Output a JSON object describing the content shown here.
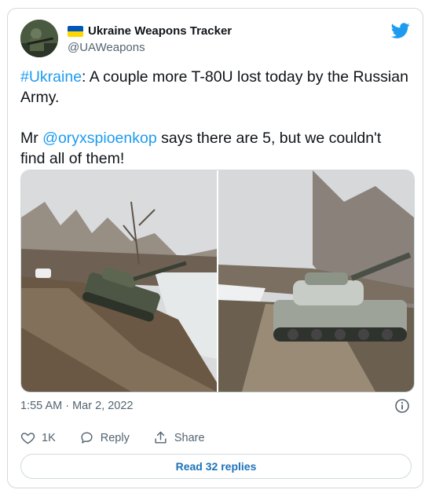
{
  "tweet": {
    "display_name": "Ukraine Weapons Tracker",
    "handle": "@UAWeapons",
    "text_line1_hashtag": "#Ukraine",
    "text_line1_rest": ": A couple more T-80U lost today by the Russian Army.",
    "text_line2_prefix": "Mr ",
    "text_line2_mention": "@oryxspioenkop",
    "text_line2_rest": " says there are 5, but we couldn't find all of them!",
    "timestamp": "1:55 AM · Mar 2, 2022",
    "likes_count": "1K",
    "reply_label": "Reply",
    "share_label": "Share",
    "read_replies_label": "Read 32 replies"
  },
  "icons": {
    "brand": "twitter-bird-icon",
    "info": "info-icon",
    "like": "heart-icon",
    "reply": "reply-icon",
    "share": "share-icon"
  },
  "colors": {
    "link": "#1d9bf0",
    "muted": "#536471",
    "border": "#cfd9de",
    "flag_blue": "#0057b7",
    "flag_yellow": "#ffd700"
  }
}
